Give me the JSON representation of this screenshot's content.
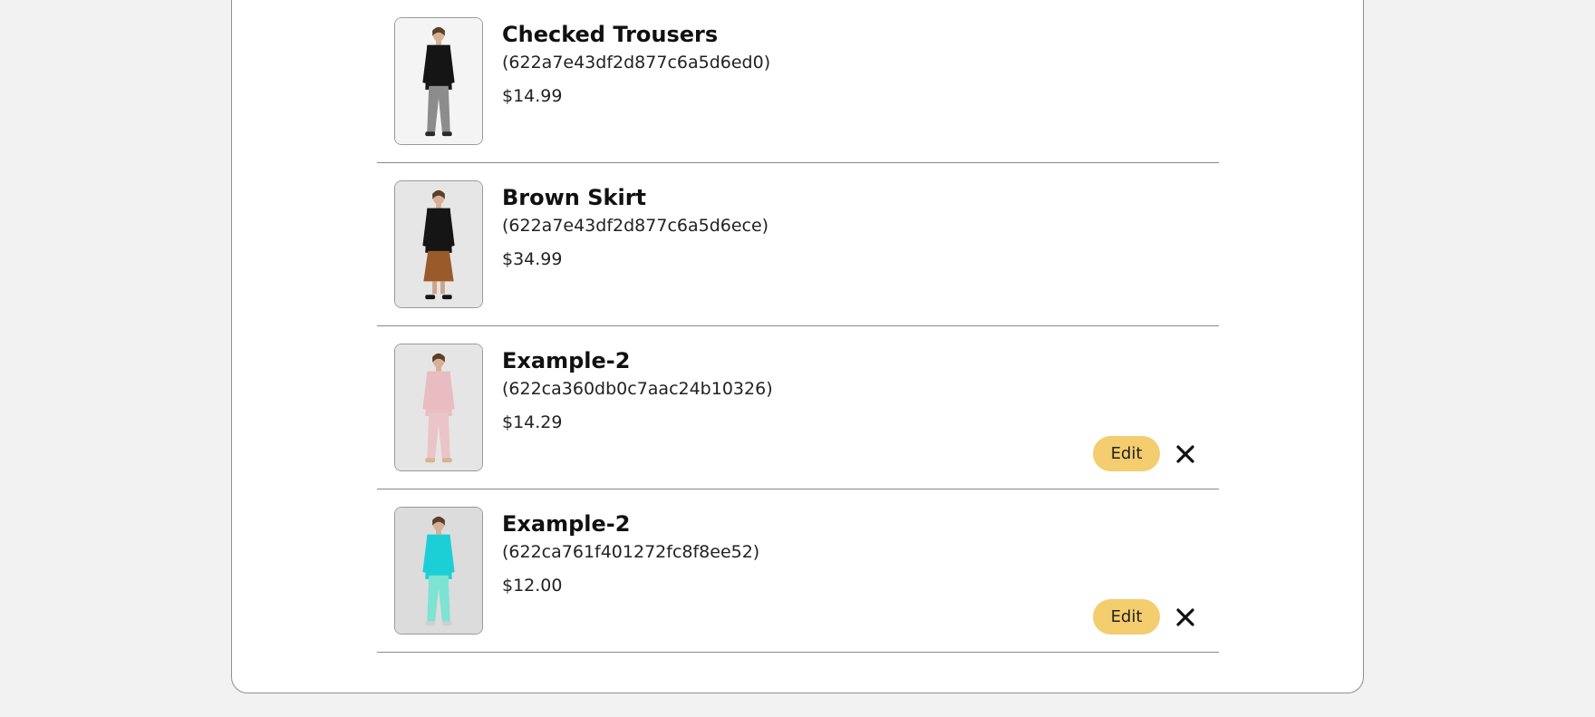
{
  "products": [
    {
      "name": "Checked Trousers",
      "id_text": "(622a7e43df2d877c6a5d6ed0)",
      "price": "$14.99",
      "editable": false,
      "image_palette": {
        "bg": "#f4f4f4",
        "top": "#151515",
        "bottom": "#8c8c8c",
        "shoe": "#2a2a2a"
      }
    },
    {
      "name": "Brown Skirt",
      "id_text": "(622a7e43df2d877c6a5d6ece)",
      "price": "$34.99",
      "editable": false,
      "image_palette": {
        "bg": "#e6e6e6",
        "top": "#151515",
        "bottom": "#9a5a2a",
        "shoe": "#151515"
      }
    },
    {
      "name": "Example-2",
      "id_text": "(622ca360db0c7aac24b10326)",
      "price": "$14.29",
      "editable": true,
      "edit_label": "Edit",
      "image_palette": {
        "bg": "#e5e5e5",
        "top": "#e8bcc0",
        "bottom": "#eac4c8",
        "shoe": "#d8b48a"
      }
    },
    {
      "name": "Example-2",
      "id_text": "(622ca761f401272fc8f8ee52)",
      "price": "$12.00",
      "editable": true,
      "edit_label": "Edit",
      "image_palette": {
        "bg": "#dcdcdc",
        "top": "#1ccfd6",
        "bottom": "#7de3d3",
        "shoe": "#cfcfcf"
      }
    }
  ],
  "colors": {
    "edit_button": "#f3cd6e",
    "divider": "#8a8a8a"
  }
}
